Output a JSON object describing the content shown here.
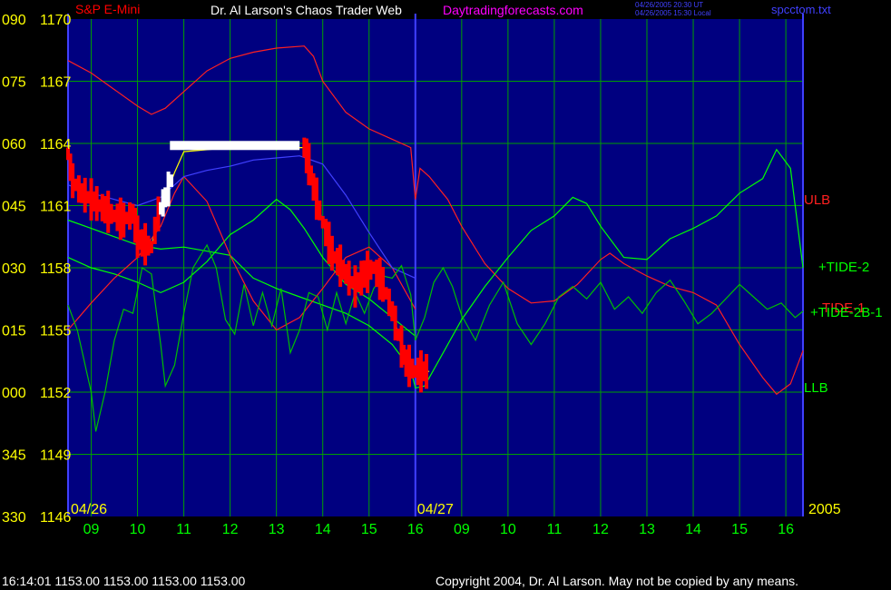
{
  "colors": {
    "page_bg": "#000000",
    "plot_bg": "#000080",
    "grid": "#00a000",
    "date_divider": "#4040ff",
    "left_axis_text": "#ffff00",
    "bottom_axis_text": "#00ff00",
    "footer_text": "#ffffff",
    "header_text": "#ffffff",
    "header_link": "#ff00ff",
    "instrument_text": "#ff0000",
    "corner_text": "#4040ff",
    "date_label_text": "#ffff00",
    "price_bar": "#ff0000",
    "price_bar_recent": "#ffffff",
    "price_line": "#ffff00",
    "ulb_line": "#ff2020",
    "llb_line": "#00ff00",
    "tide2_line": "#00ff00",
    "tide1_line": "#ff2020",
    "tide2b1_line": "#00c000",
    "mid_line": "#4040ff",
    "ulb_label": "#ff2020",
    "llb_label": "#00ff00",
    "tide2_label": "#00ff00",
    "tide1_label": "#ff2020",
    "tide2b1_label": "#00ff00"
  },
  "header": {
    "instrument": "S&P E-Mini",
    "title": "Dr. Al Larson's Chaos Trader Web",
    "site": "Daytradingforecasts.com",
    "timestamp_ut": "04/26/2005 20:30 UT",
    "timestamp_local": "04/26/2005 15:30 Local",
    "filename": "spcctom.txt"
  },
  "footer": {
    "last_quote": "16:14:01  1153.00 1153.00 1153.00 1153.00",
    "copyright": "Copyright 2004, Dr. Al Larson. May not be copied by any means."
  },
  "chart_data": {
    "type": "line",
    "title": "S&P E-Mini",
    "xlabel": "",
    "ylabel": "",
    "y_left_ticks": [
      {
        "angle": "090",
        "price": "1170"
      },
      {
        "angle": "075",
        "price": "1167"
      },
      {
        "angle": "060",
        "price": "1164"
      },
      {
        "angle": "045",
        "price": "1161"
      },
      {
        "angle": "030",
        "price": "1158"
      },
      {
        "angle": "015",
        "price": "1155"
      },
      {
        "angle": "000",
        "price": "1152"
      },
      {
        "angle": "345",
        "price": "1149"
      },
      {
        "angle": "330",
        "price": "1146"
      }
    ],
    "ylim": [
      1146,
      1170
    ],
    "x_hour_ticks": [
      "09",
      "10",
      "11",
      "12",
      "13",
      "14",
      "15",
      "16",
      "09",
      "10",
      "11",
      "12",
      "13",
      "14",
      "15",
      "16"
    ],
    "date_labels": [
      "04/26",
      "04/27"
    ],
    "year_label": "2005",
    "x_range_hours": [
      8.5,
      24.37
    ],
    "x_axis_note": "x measured in hours from 00:00 of 04/26; session day 2 (04/27) starts at x=16.0 and its hour ticks continue at 17..24",
    "series": [
      {
        "name": "ULB",
        "points": [
          [
            8.5,
            1168.0
          ],
          [
            9.0,
            1167.4
          ],
          [
            9.5,
            1166.6
          ],
          [
            10.0,
            1165.8
          ],
          [
            10.3,
            1165.4
          ],
          [
            10.6,
            1165.7
          ],
          [
            11.0,
            1166.5
          ],
          [
            11.5,
            1167.5
          ],
          [
            12.0,
            1168.1
          ],
          [
            12.5,
            1168.4
          ],
          [
            13.0,
            1168.6
          ],
          [
            13.6,
            1168.7
          ],
          [
            13.8,
            1168.2
          ],
          [
            14.0,
            1167.0
          ],
          [
            14.5,
            1165.5
          ],
          [
            15.0,
            1164.7
          ],
          [
            15.5,
            1164.2
          ],
          [
            15.9,
            1163.8
          ],
          [
            16.0,
            1161.3
          ],
          [
            16.1,
            1162.8
          ],
          [
            16.3,
            1162.4
          ],
          [
            16.7,
            1161.3
          ],
          [
            17.0,
            1160.0
          ],
          [
            17.5,
            1158.2
          ],
          [
            18.0,
            1157.0
          ],
          [
            18.5,
            1156.3
          ],
          [
            19.0,
            1156.4
          ],
          [
            19.5,
            1157.2
          ],
          [
            20.0,
            1158.4
          ],
          [
            20.2,
            1158.7
          ],
          [
            20.5,
            1158.2
          ],
          [
            21.0,
            1157.6
          ],
          [
            21.5,
            1157.1
          ],
          [
            22.0,
            1156.8
          ],
          [
            22.5,
            1156.2
          ],
          [
            23.0,
            1154.3
          ],
          [
            23.5,
            1152.7
          ],
          [
            23.8,
            1151.9
          ],
          [
            24.1,
            1152.4
          ],
          [
            24.37,
            1154.0
          ]
        ]
      },
      {
        "name": "LLB",
        "points": [
          [
            8.5,
            1160.3
          ],
          [
            9.0,
            1159.9
          ],
          [
            9.5,
            1159.5
          ],
          [
            10.0,
            1159.1
          ],
          [
            10.5,
            1158.9
          ],
          [
            11.0,
            1159.0
          ],
          [
            11.5,
            1158.8
          ],
          [
            12.0,
            1158.6
          ],
          [
            12.5,
            1157.5
          ],
          [
            13.0,
            1157.0
          ],
          [
            13.5,
            1156.6
          ],
          [
            14.0,
            1156.2
          ],
          [
            14.5,
            1155.8
          ],
          [
            15.0,
            1155.2
          ],
          [
            15.5,
            1154.3
          ],
          [
            15.9,
            1153.1
          ],
          [
            16.0,
            1152.2
          ],
          [
            16.2,
            1152.3
          ],
          [
            16.5,
            1153.5
          ],
          [
            17.0,
            1155.5
          ],
          [
            17.5,
            1157.1
          ],
          [
            18.0,
            1158.5
          ],
          [
            18.5,
            1159.8
          ],
          [
            19.0,
            1160.5
          ],
          [
            19.4,
            1161.4
          ],
          [
            19.7,
            1161.1
          ],
          [
            20.0,
            1160.0
          ],
          [
            20.5,
            1158.5
          ],
          [
            21.0,
            1158.4
          ],
          [
            21.5,
            1159.4
          ],
          [
            22.0,
            1159.9
          ],
          [
            22.5,
            1160.5
          ],
          [
            23.0,
            1161.6
          ],
          [
            23.5,
            1162.3
          ],
          [
            23.8,
            1163.7
          ],
          [
            24.1,
            1162.8
          ],
          [
            24.37,
            1158.0
          ]
        ]
      },
      {
        "name": "+TIDE-2",
        "points": [
          [
            8.5,
            1158.5
          ],
          [
            9.0,
            1158.0
          ],
          [
            9.5,
            1157.7
          ],
          [
            10.0,
            1157.3
          ],
          [
            10.5,
            1156.8
          ],
          [
            11.0,
            1157.3
          ],
          [
            11.5,
            1158.3
          ],
          [
            12.0,
            1159.6
          ],
          [
            12.5,
            1160.3
          ],
          [
            13.0,
            1161.3
          ],
          [
            13.3,
            1160.8
          ],
          [
            13.6,
            1159.9
          ],
          [
            14.0,
            1158.5
          ],
          [
            14.5,
            1157.2
          ],
          [
            15.0,
            1156.5
          ],
          [
            15.5,
            1155.6
          ],
          [
            16.0,
            1154.7
          ]
        ]
      },
      {
        "name": "TIDE-1",
        "points": [
          [
            8.5,
            1155.0
          ],
          [
            9.0,
            1156.3
          ],
          [
            9.5,
            1157.5
          ],
          [
            10.0,
            1158.5
          ],
          [
            10.5,
            1160.0
          ],
          [
            10.8,
            1161.6
          ],
          [
            11.0,
            1162.4
          ],
          [
            11.5,
            1161.2
          ],
          [
            12.0,
            1158.6
          ],
          [
            12.5,
            1156.4
          ],
          [
            13.0,
            1155.0
          ],
          [
            13.5,
            1155.6
          ],
          [
            14.0,
            1157.0
          ],
          [
            14.5,
            1158.5
          ],
          [
            15.0,
            1159.0
          ],
          [
            15.5,
            1158.0
          ],
          [
            16.0,
            1156.0
          ]
        ]
      },
      {
        "name": "Envelope",
        "points": [
          [
            8.5,
            1162.0
          ],
          [
            9.0,
            1161.6
          ],
          [
            9.5,
            1161.3
          ],
          [
            10.0,
            1161.0
          ],
          [
            10.5,
            1161.4
          ],
          [
            11.0,
            1162.4
          ],
          [
            11.5,
            1162.7
          ],
          [
            12.0,
            1162.9
          ],
          [
            12.5,
            1163.2
          ],
          [
            13.0,
            1163.3
          ],
          [
            13.5,
            1163.4
          ],
          [
            14.0,
            1163.0
          ],
          [
            14.5,
            1161.5
          ],
          [
            15.0,
            1159.7
          ],
          [
            15.5,
            1158.0
          ],
          [
            16.0,
            1157.5
          ]
        ]
      },
      {
        "name": "Price",
        "points": [
          [
            8.5,
            1163.5
          ],
          [
            8.6,
            1162.2
          ],
          [
            8.8,
            1161.6
          ],
          [
            9.0,
            1161.3
          ],
          [
            9.3,
            1160.8
          ],
          [
            9.5,
            1160.5
          ],
          [
            9.7,
            1160.3
          ],
          [
            9.9,
            1160.6
          ],
          [
            10.0,
            1159.5
          ],
          [
            10.1,
            1159.2
          ],
          [
            10.3,
            1159.0
          ],
          [
            10.45,
            1160.6
          ],
          [
            10.6,
            1161.4
          ],
          [
            10.8,
            1162.6
          ],
          [
            11.0,
            1163.6
          ],
          [
            12.0,
            1163.8
          ],
          [
            13.0,
            1163.8
          ],
          [
            13.6,
            1163.8
          ],
          [
            13.7,
            1163.0
          ],
          [
            13.8,
            1161.9
          ],
          [
            14.0,
            1160.2
          ],
          [
            14.2,
            1158.7
          ],
          [
            14.5,
            1157.7
          ],
          [
            14.7,
            1157.1
          ],
          [
            14.9,
            1157.7
          ],
          [
            15.1,
            1158.0
          ],
          [
            15.3,
            1157.2
          ],
          [
            15.5,
            1155.9
          ],
          [
            15.7,
            1154.2
          ],
          [
            15.8,
            1153.4
          ],
          [
            16.0,
            1153.0
          ],
          [
            16.3,
            1153.0
          ]
        ]
      },
      {
        "name": "+TIDE-2B-1",
        "points": [
          [
            8.5,
            1156.2
          ],
          [
            8.7,
            1155.0
          ],
          [
            8.9,
            1153.0
          ],
          [
            9.0,
            1152.0
          ],
          [
            9.1,
            1150.1
          ],
          [
            9.3,
            1152.0
          ],
          [
            9.5,
            1154.5
          ],
          [
            9.7,
            1156.0
          ],
          [
            9.9,
            1155.8
          ],
          [
            10.1,
            1158.0
          ],
          [
            10.3,
            1157.7
          ],
          [
            10.5,
            1154.3
          ],
          [
            10.6,
            1152.3
          ],
          [
            10.8,
            1153.3
          ],
          [
            11.0,
            1155.8
          ],
          [
            11.2,
            1158.0
          ],
          [
            11.5,
            1159.1
          ],
          [
            11.7,
            1158.0
          ],
          [
            11.9,
            1155.5
          ],
          [
            12.1,
            1154.8
          ],
          [
            12.3,
            1157.2
          ],
          [
            12.5,
            1155.2
          ],
          [
            12.7,
            1156.8
          ],
          [
            12.9,
            1155.2
          ],
          [
            13.1,
            1157.0
          ],
          [
            13.3,
            1153.9
          ],
          [
            13.5,
            1155.0
          ],
          [
            13.7,
            1156.8
          ],
          [
            13.9,
            1156.6
          ],
          [
            14.1,
            1155.0
          ],
          [
            14.3,
            1156.8
          ],
          [
            14.5,
            1155.3
          ],
          [
            14.7,
            1156.8
          ],
          [
            14.9,
            1155.8
          ],
          [
            15.1,
            1157.0
          ],
          [
            15.3,
            1157.6
          ],
          [
            15.5,
            1157.5
          ],
          [
            15.7,
            1158.1
          ],
          [
            15.9,
            1156.7
          ],
          [
            16.0,
            1154.5
          ],
          [
            16.2,
            1155.6
          ],
          [
            16.4,
            1157.3
          ],
          [
            16.6,
            1158.0
          ],
          [
            16.8,
            1157.1
          ],
          [
            17.0,
            1155.7
          ],
          [
            17.3,
            1154.5
          ],
          [
            17.6,
            1156.2
          ],
          [
            17.9,
            1157.3
          ],
          [
            18.2,
            1155.3
          ],
          [
            18.5,
            1154.3
          ],
          [
            18.8,
            1155.3
          ],
          [
            19.1,
            1156.6
          ],
          [
            19.4,
            1157.1
          ],
          [
            19.7,
            1156.5
          ],
          [
            20.0,
            1157.3
          ],
          [
            20.3,
            1156.0
          ],
          [
            20.6,
            1156.6
          ],
          [
            20.9,
            1155.8
          ],
          [
            21.2,
            1156.8
          ],
          [
            21.5,
            1157.4
          ],
          [
            21.8,
            1156.4
          ],
          [
            22.1,
            1155.3
          ],
          [
            22.4,
            1155.8
          ],
          [
            22.7,
            1156.5
          ],
          [
            23.0,
            1157.2
          ],
          [
            23.3,
            1156.6
          ],
          [
            23.6,
            1156.0
          ],
          [
            23.9,
            1156.3
          ],
          [
            24.2,
            1155.6
          ],
          [
            24.37,
            1155.9
          ]
        ]
      }
    ],
    "highlight_bar": {
      "x_start": 10.7,
      "x_end": 13.5,
      "y": 1163.9
    },
    "annotations": [
      {
        "text": "ULB",
        "series": "ULB"
      },
      {
        "text": "+TIDE-2",
        "series": "+TIDE-2"
      },
      {
        "text": "TIDE-1",
        "series": "TIDE-1"
      },
      {
        "text": "+TIDE-2B-1",
        "series": "+TIDE-2B-1"
      },
      {
        "text": "LLB",
        "series": "LLB"
      }
    ],
    "legend": "none",
    "grid": true
  }
}
